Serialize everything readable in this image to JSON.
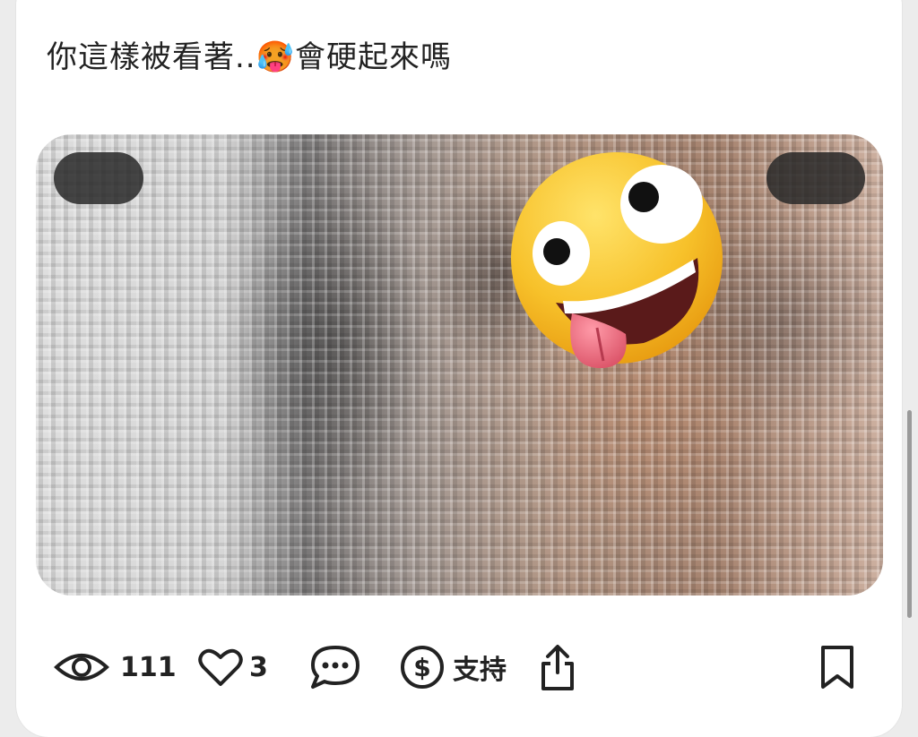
{
  "post": {
    "text_before_emoji": "你這樣被看著..",
    "emoji_inline": "🥵",
    "text_after_emoji": "會硬起來嗎"
  },
  "media": {
    "sticker": "zany-face-emoji",
    "blurred": true
  },
  "actions": {
    "views_icon": "eye-icon",
    "views_count": "111",
    "likes_icon": "heart-icon",
    "likes_count": "3",
    "comment_icon": "comment-icon",
    "support_icon": "dollar-circle-icon",
    "support_label": "支持",
    "share_icon": "share-icon",
    "bookmark_icon": "bookmark-icon"
  }
}
